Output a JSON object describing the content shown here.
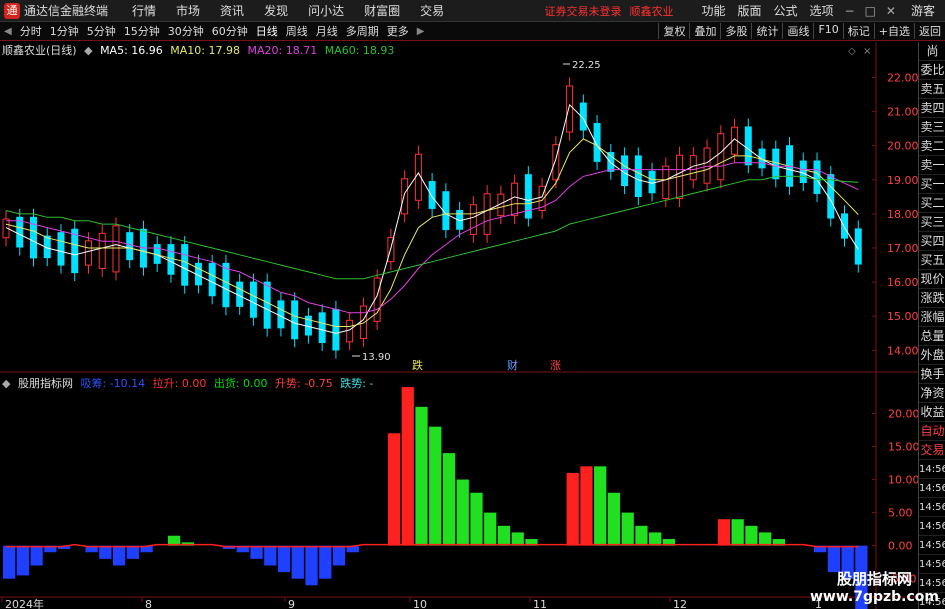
{
  "app": {
    "title": "通达信金融终端",
    "logo_glyph": "通"
  },
  "menu": [
    "行情",
    "市场",
    "资讯",
    "发现",
    "问小达",
    "财富圈",
    "交易"
  ],
  "warning": "证券交易未登录",
  "stock_name_top": "顺鑫农业",
  "right_menu": [
    "功能",
    "版面",
    "公式",
    "选项"
  ],
  "window_controls": [
    "−",
    "□",
    "✕"
  ],
  "guest": "游客",
  "periods": [
    "分时",
    "1分钟",
    "5分钟",
    "15分钟",
    "30分钟",
    "60分钟",
    "日线",
    "周线",
    "月线",
    "多周期",
    "更多"
  ],
  "active_period": "日线",
  "toolbar_right": [
    "复权",
    "叠加",
    "多股",
    "统计",
    "画线",
    "F10",
    "标记",
    "+自选",
    "返回"
  ],
  "main_info": {
    "title": "顺鑫农业(日线)",
    "ma5": "MA5: 16.96",
    "ma10": "MA10: 17.98",
    "ma20": "MA20: 18.71",
    "ma60": "MA60: 18.93"
  },
  "indicator_info": {
    "name": "股朋指标网",
    "a": "吸筹: -10.14",
    "b": "拉升: 0.00",
    "c": "出货: 0.00",
    "d": "升势: -0.75",
    "e": "跌势: -"
  },
  "price_labels": {
    "high": "22.25",
    "low": "13.90"
  },
  "markers": [
    "跌",
    "财",
    "涨"
  ],
  "side_items": [
    "委比",
    "卖五",
    "卖四",
    "卖三",
    "卖二",
    "卖一",
    "买一",
    "买二",
    "买三",
    "买四",
    "买五",
    "现价",
    "涨跌",
    "涨幅",
    "总量",
    "外盘",
    "换手",
    "净资",
    "收益",
    "自动",
    "交易"
  ],
  "side_indicator_ticks": [
    "14:56",
    "14:56",
    "14:56",
    "14:56",
    "14:56",
    "14:56",
    "14:56",
    "14:56",
    "14:56"
  ],
  "side_top_text": "尚",
  "watermark": {
    "line1": "股朋指标网",
    "line2": "www.7gpzb.com"
  },
  "colors": {
    "up": "#ff3232",
    "down": "#00e0ff",
    "ma5": "#ffffff",
    "ma10": "#e8e86a",
    "ma20": "#e040e0",
    "ma60": "#30c030",
    "bg": "#000000"
  },
  "chart_data": [
    {
      "type": "candlestick",
      "title": "顺鑫农业(日线)",
      "ylim": [
        13.6,
        22.6
      ],
      "yticks": [
        14.0,
        15.0,
        16.0,
        17.0,
        18.0,
        19.0,
        20.0,
        21.0,
        22.0
      ],
      "x_labels": [
        "2024年",
        "8",
        "9",
        "10",
        "11",
        "12",
        "1"
      ],
      "series": [
        {
          "name": "MA5",
          "values": [
            17.6,
            17.4,
            17.2,
            17.0,
            16.9,
            16.8,
            16.9,
            17.0,
            17.1,
            17.0,
            16.9,
            16.8,
            16.6,
            16.4,
            16.2,
            16.0,
            15.8,
            15.6,
            15.4,
            15.2,
            15.0,
            14.8,
            14.7,
            14.6,
            14.5,
            14.6,
            14.9,
            15.6,
            17.0,
            18.6,
            19.2,
            18.5,
            18.0,
            17.8,
            17.9,
            18.1,
            18.3,
            18.5,
            18.4,
            18.5,
            19.6,
            21.2,
            20.8,
            20.0,
            19.5,
            19.2,
            19.0,
            18.9,
            19.0,
            19.2,
            19.4,
            19.5,
            19.8,
            20.2,
            19.9,
            19.6,
            19.4,
            19.3,
            19.2,
            19.0,
            18.4,
            17.6,
            16.96
          ]
        },
        {
          "name": "MA10",
          "values": [
            17.7,
            17.6,
            17.5,
            17.3,
            17.2,
            17.1,
            17.0,
            17.0,
            17.0,
            17.0,
            16.9,
            16.8,
            16.7,
            16.6,
            16.4,
            16.2,
            16.0,
            15.8,
            15.6,
            15.4,
            15.2,
            15.0,
            14.9,
            14.8,
            14.7,
            14.7,
            14.8,
            15.1,
            15.8,
            16.8,
            17.6,
            17.9,
            18.0,
            18.0,
            18.0,
            18.1,
            18.2,
            18.3,
            18.3,
            18.4,
            18.9,
            19.8,
            20.2,
            20.0,
            19.7,
            19.4,
            19.2,
            19.0,
            19.0,
            19.1,
            19.2,
            19.3,
            19.5,
            19.7,
            19.7,
            19.6,
            19.5,
            19.4,
            19.3,
            19.2,
            18.8,
            18.4,
            17.98
          ]
        },
        {
          "name": "MA20",
          "values": [
            17.8,
            17.8,
            17.7,
            17.6,
            17.5,
            17.4,
            17.3,
            17.2,
            17.2,
            17.1,
            17.0,
            17.0,
            16.9,
            16.8,
            16.7,
            16.6,
            16.4,
            16.3,
            16.1,
            15.9,
            15.7,
            15.6,
            15.4,
            15.3,
            15.2,
            15.1,
            15.1,
            15.2,
            15.5,
            15.9,
            16.4,
            16.8,
            17.1,
            17.4,
            17.6,
            17.8,
            17.9,
            18.0,
            18.1,
            18.2,
            18.4,
            18.8,
            19.1,
            19.2,
            19.3,
            19.3,
            19.3,
            19.3,
            19.3,
            19.3,
            19.3,
            19.4,
            19.4,
            19.5,
            19.5,
            19.5,
            19.4,
            19.4,
            19.3,
            19.3,
            19.1,
            18.9,
            18.71
          ]
        },
        {
          "name": "MA60",
          "values": [
            18.1,
            18.0,
            18.0,
            17.9,
            17.9,
            17.8,
            17.8,
            17.7,
            17.7,
            17.6,
            17.5,
            17.4,
            17.3,
            17.2,
            17.1,
            17.0,
            16.9,
            16.8,
            16.7,
            16.6,
            16.5,
            16.4,
            16.3,
            16.2,
            16.1,
            16.1,
            16.1,
            16.2,
            16.3,
            16.4,
            16.5,
            16.6,
            16.7,
            16.8,
            16.9,
            17.0,
            17.1,
            17.2,
            17.3,
            17.4,
            17.5,
            17.7,
            17.8,
            17.9,
            18.0,
            18.1,
            18.2,
            18.3,
            18.4,
            18.5,
            18.6,
            18.7,
            18.8,
            18.9,
            19.0,
            19.0,
            19.1,
            19.1,
            19.1,
            19.0,
            19.0,
            18.95,
            18.93
          ]
        }
      ]
    },
    {
      "type": "bar",
      "title": "股朋指标网",
      "ylim": [
        -5.5,
        24
      ],
      "yticks": [
        -5.0,
        0.0,
        5.0,
        10.0,
        15.0,
        20.0
      ],
      "series": [
        {
          "name": "吸筹",
          "values": [
            -5,
            -4.5,
            -3,
            -1,
            -0.5,
            0,
            -1,
            -2,
            -3,
            -2,
            -1,
            0,
            0,
            0,
            0,
            0,
            -0.5,
            -1,
            -2,
            -3,
            -4,
            -5,
            -6,
            -5,
            -3,
            -1,
            0,
            0,
            0,
            0,
            0,
            0,
            0,
            0,
            0,
            0,
            0,
            0,
            0,
            0,
            0,
            0,
            0,
            0,
            0,
            0,
            0,
            0,
            0,
            0,
            0,
            0,
            0,
            0,
            0,
            0,
            0,
            0,
            0,
            -1,
            -4,
            -5,
            -10.14
          ]
        },
        {
          "name": "拉升",
          "values": [
            0,
            0,
            0,
            0,
            0,
            0,
            0,
            0,
            0,
            0,
            0,
            0,
            0,
            0,
            0,
            0,
            0,
            0,
            0,
            0,
            0,
            0,
            0,
            0,
            0,
            0,
            0,
            0,
            17,
            24,
            0,
            0,
            0,
            0,
            0,
            0,
            0,
            0,
            0,
            0,
            0,
            11,
            12,
            0,
            0,
            0,
            0,
            0,
            0,
            0,
            0,
            0,
            4,
            0,
            0,
            0,
            0,
            0,
            0,
            0,
            0,
            0,
            0
          ]
        },
        {
          "name": "出货",
          "values": [
            0,
            0,
            0,
            0,
            0,
            0,
            0,
            0,
            0,
            0,
            0,
            0,
            1.5,
            0.5,
            0,
            0,
            0,
            0,
            0,
            0,
            0,
            0,
            0,
            0,
            0,
            0,
            0,
            0,
            0,
            0,
            21,
            18,
            14,
            10,
            8,
            5,
            3,
            2,
            1,
            0,
            0,
            0,
            0,
            12,
            8,
            5,
            3,
            2,
            1,
            0,
            0,
            0,
            0,
            4,
            3,
            2,
            1,
            0,
            0,
            0,
            0,
            0,
            0
          ]
        }
      ]
    }
  ]
}
